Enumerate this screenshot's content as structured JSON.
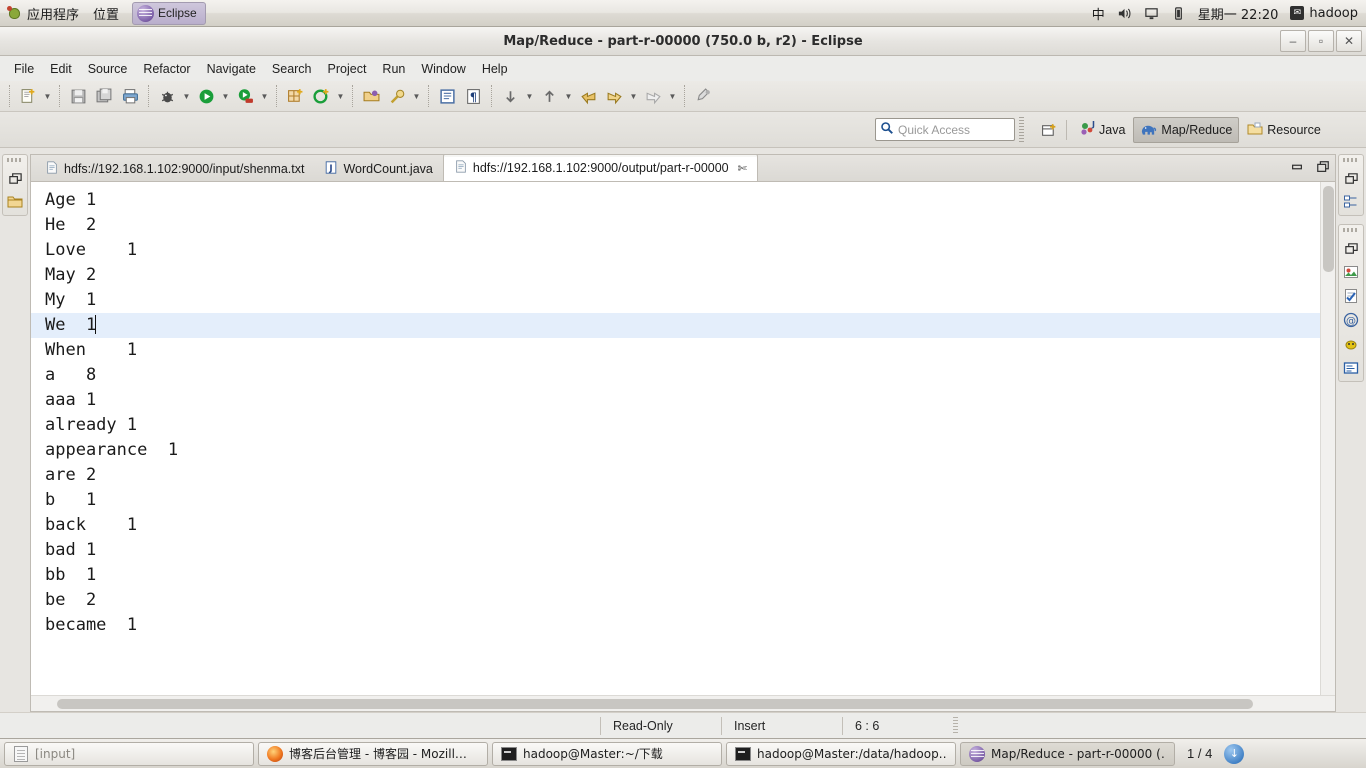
{
  "gnome_panel": {
    "applications_label": "应用程序",
    "places_label": "位置",
    "window_button": "Eclipse",
    "tray": {
      "ime": "中",
      "volume_icon": "volume-icon",
      "display_icon": "display-icon",
      "battery_icon": "battery-icon"
    },
    "clock": "星期一 22:20",
    "user": "hadoop"
  },
  "window": {
    "title": "Map/Reduce - part-r-00000 (750.0 b, r2) - Eclipse",
    "minimize": "–",
    "maximize": "▫",
    "close": "✕"
  },
  "menu": {
    "items": [
      {
        "label": "File"
      },
      {
        "label": "Edit"
      },
      {
        "label": "Source"
      },
      {
        "label": "Refactor"
      },
      {
        "label": "Navigate"
      },
      {
        "label": "Search"
      },
      {
        "label": "Project"
      },
      {
        "label": "Run"
      },
      {
        "label": "Window"
      },
      {
        "label": "Help"
      }
    ]
  },
  "toolbar": {
    "groups": [
      {
        "buttons": [
          {
            "name": "new-wizard-icon",
            "has_arrow": true
          }
        ]
      },
      {
        "buttons": [
          {
            "name": "save-icon",
            "has_arrow": false
          },
          {
            "name": "save-all-icon",
            "has_arrow": false
          },
          {
            "name": "print-icon",
            "has_arrow": false
          }
        ]
      },
      {
        "buttons": [
          {
            "name": "debug-icon",
            "has_arrow": true
          },
          {
            "name": "run-icon",
            "has_arrow": true
          },
          {
            "name": "run-external-tools-icon",
            "has_arrow": true
          }
        ]
      },
      {
        "buttons": [
          {
            "name": "new-java-package-icon",
            "has_arrow": false
          },
          {
            "name": "new-java-class-icon",
            "has_arrow": true
          }
        ]
      },
      {
        "buttons": [
          {
            "name": "open-type-icon",
            "has_arrow": false
          },
          {
            "name": "search-icon",
            "has_arrow": true
          }
        ]
      },
      {
        "buttons": [
          {
            "name": "toggle-mark-occurrences-icon",
            "has_arrow": false
          },
          {
            "name": "show-whitespace-icon",
            "has_arrow": false
          }
        ]
      },
      {
        "buttons": [
          {
            "name": "next-annotation-icon",
            "has_arrow": true
          },
          {
            "name": "previous-annotation-icon",
            "has_arrow": true
          },
          {
            "name": "back-icon",
            "has_arrow": false
          },
          {
            "name": "forward-icon",
            "has_arrow": true
          },
          {
            "name": "last-edit-location-icon",
            "has_arrow": true
          }
        ]
      },
      {
        "buttons": [
          {
            "name": "pin-editor-icon",
            "has_arrow": false
          }
        ]
      }
    ]
  },
  "quick_access": {
    "placeholder": "Quick Access",
    "icon": "search-icon"
  },
  "perspectives": {
    "open_perspective_icon": "open-perspective-icon",
    "items": [
      {
        "label": "Java",
        "icon": "java-perspective-icon",
        "active": false
      },
      {
        "label": "Map/Reduce",
        "icon": "elephant-icon",
        "active": true
      },
      {
        "label": "Resource",
        "icon": "resource-perspective-icon",
        "active": false
      }
    ]
  },
  "left_strip": {
    "groups": [
      {
        "icons": [
          "restore-icon",
          "project-explorer-icon"
        ]
      }
    ]
  },
  "right_strip": {
    "groups": [
      {
        "icons": [
          "restore-icon",
          "outline-icon"
        ]
      },
      {
        "icons": [
          "restore-icon",
          "map-reduce-locations-icon",
          "tasks-icon",
          "javadoc-icon",
          "problems-icon",
          "console-icon"
        ]
      }
    ]
  },
  "editor": {
    "tabs": [
      {
        "label": "hdfs://192.168.1.102:9000/input/shenma.txt",
        "icon": "text-file-icon",
        "active": false,
        "closable": false
      },
      {
        "label": "WordCount.java",
        "icon": "java-file-icon",
        "active": false,
        "closable": false
      },
      {
        "label": "hdfs://192.168.1.102:9000/output/part-r-00000",
        "icon": "text-file-icon",
        "active": true,
        "closable": true
      }
    ],
    "tab_close_glyph": "✄",
    "tools": [
      {
        "name": "minimize-editor-icon",
        "glyph": "▭"
      },
      {
        "name": "maximize-editor-icon",
        "glyph": "❐"
      }
    ],
    "current_line_index": 5,
    "lines": [
      "Age\t1",
      "He\t2",
      "Love\t1",
      "May\t2",
      "My\t1",
      "We\t1",
      "When\t1",
      "a\t8",
      "aaa\t1",
      "already\t1",
      "appearance\t1",
      "are\t2",
      "b\t1",
      "back\t1",
      "bad\t1",
      "bb\t1",
      "be\t2",
      "became\t1"
    ]
  },
  "status_bar": {
    "read_only": "Read-Only",
    "insert_mode": "Insert",
    "position": "6 : 6"
  },
  "taskbar": {
    "items": [
      {
        "label": "[input]",
        "icon": "window-list-icon",
        "active": false,
        "dim": true
      },
      {
        "label": "博客后台管理 - 博客园 - Mozill…",
        "icon": "firefox-icon",
        "active": false,
        "dim": false
      },
      {
        "label": "hadoop@Master:~/下载",
        "icon": "terminal-icon",
        "active": false,
        "dim": false
      },
      {
        "label": "hadoop@Master:/data/hadoop…",
        "icon": "terminal-icon",
        "active": false,
        "dim": false
      },
      {
        "label": "Map/Reduce - part-r-00000 (…",
        "icon": "eclipse-icon",
        "active": true,
        "dim": false
      }
    ],
    "pager": "1 / 4",
    "trash_icon": "trash-icon"
  }
}
